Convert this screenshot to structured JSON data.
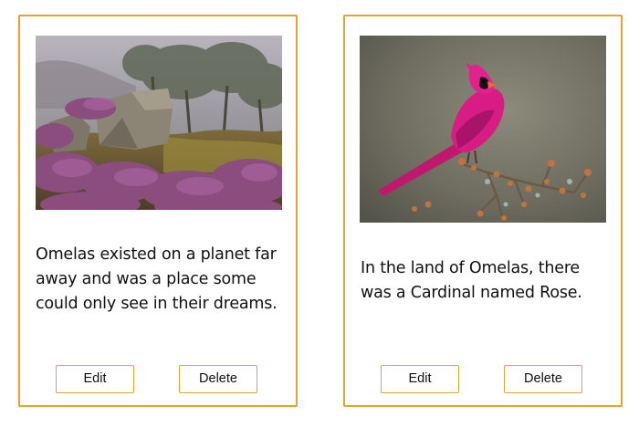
{
  "cards": [
    {
      "image_subject": "misty moorland with heather, rocks and trees",
      "text": "Omelas existed on a planet far away and was a place some could only see in their dreams.",
      "edit_label": "Edit",
      "delete_label": "Delete"
    },
    {
      "image_subject": "pink cardinal perched on a branch",
      "text": "In the land of Omelas, there was a Cardinal named Rose.",
      "edit_label": "Edit",
      "delete_label": "Delete"
    }
  ],
  "colors": {
    "accent": "#e6a12f",
    "text": "#111111",
    "background": "#ffffff"
  }
}
